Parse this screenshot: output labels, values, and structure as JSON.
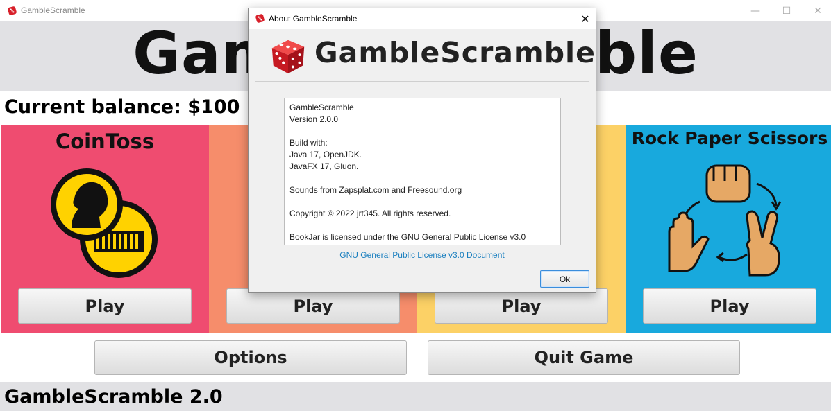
{
  "window": {
    "title": "GambleScramble"
  },
  "header": {
    "title": "GambleScramble"
  },
  "balance": "Current balance: $100",
  "panels": [
    {
      "title": "CoinToss",
      "play_label": "Play",
      "color": "#ef4c70"
    },
    {
      "title": "",
      "play_label": "Play",
      "color": "#f68d6b"
    },
    {
      "title": "",
      "play_label": "Play",
      "color": "#fcd166"
    },
    {
      "title": "Rock Paper Scissors",
      "play_label": "Play",
      "color": "#18a9dd"
    }
  ],
  "bottom_buttons": {
    "options": "Options",
    "quit": "Quit Game"
  },
  "footer": {
    "text": "GambleScramble 2.0"
  },
  "about": {
    "window_title": "About GambleScramble",
    "app_name": "GambleScramble",
    "lines": [
      "GambleScramble",
      "Version 2.0.0",
      "",
      "Build with:",
      "Java 17, OpenJDK.",
      "JavaFX 17, Gluon.",
      "",
      "Sounds from Zapsplat.com and Freesound.org",
      "",
      "Copyright © 2022 jrt345. All rights reserved.",
      "",
      "BookJar is licensed under the GNU General Public License v3.0"
    ],
    "license_link": "GNU General Public License v3.0 Document",
    "ok_label": "Ok"
  },
  "icons": {
    "app": "red-dice-icon",
    "coin": "coin-head-icon",
    "rps": "rock-paper-scissors-cycle-icon"
  },
  "colors": {
    "header_band": "#e1e1e4",
    "dice_red": "#d8202a",
    "link": "#1a7fbf"
  }
}
